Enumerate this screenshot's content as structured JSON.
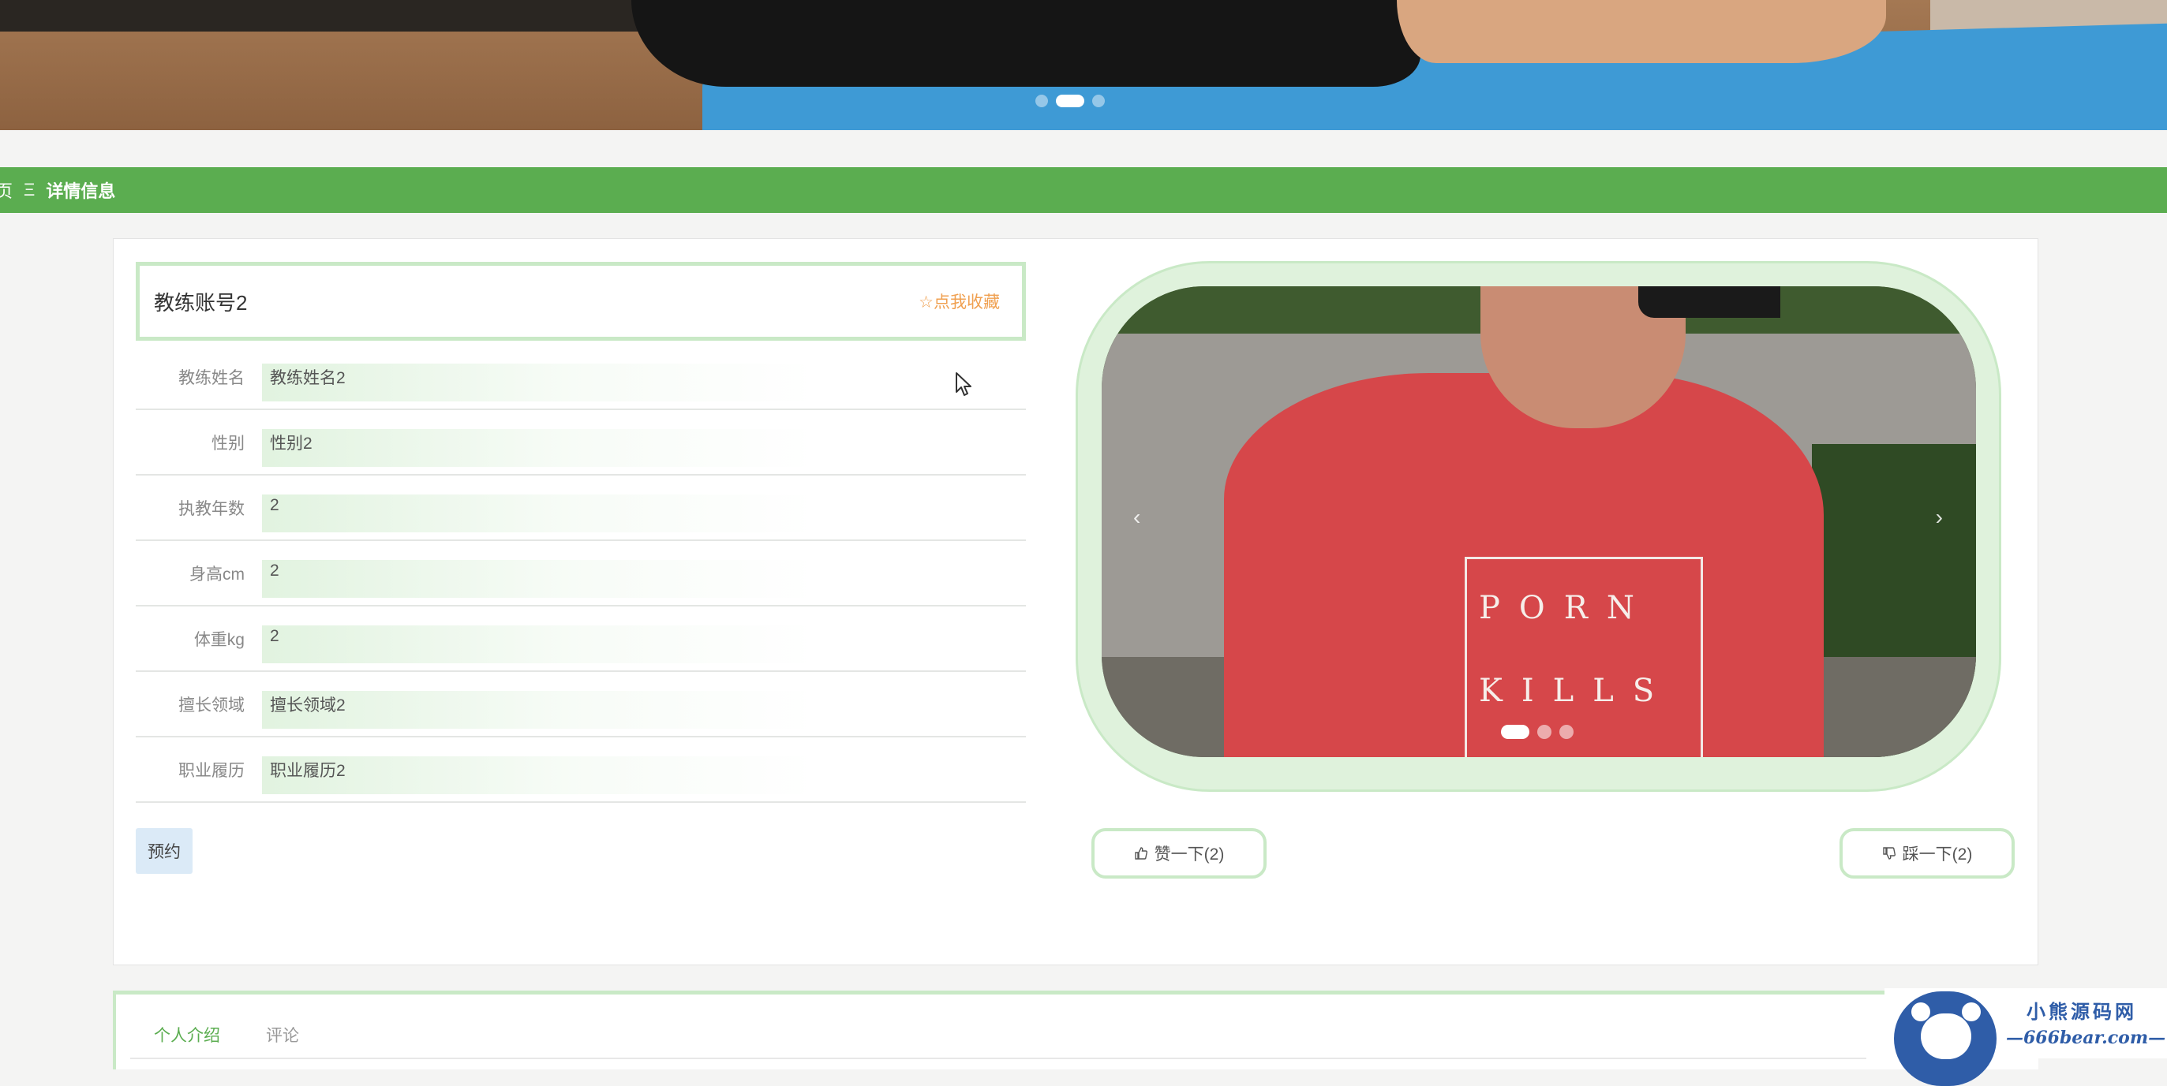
{
  "breadcrumb": {
    "home": "页",
    "separator": "Ξ",
    "current": "详情信息"
  },
  "detail": {
    "title": "教练账号2",
    "favorite_label": "☆点我收藏",
    "rows": [
      {
        "label": "教练姓名",
        "value": "教练姓名2"
      },
      {
        "label": "性别",
        "value": "性别2"
      },
      {
        "label": "执教年数",
        "value": "2"
      },
      {
        "label": "身高cm",
        "value": "2"
      },
      {
        "label": "体重kg",
        "value": "2"
      },
      {
        "label": "擅长领域",
        "value": "擅长领域2"
      },
      {
        "label": "职业履历",
        "value": "职业履历2"
      }
    ],
    "book_button": "预约"
  },
  "carousel": {
    "prev_glyph": "‹",
    "next_glyph": "›",
    "slide_count": 3,
    "active_slide": 1,
    "shirt_text_line1": "PORN",
    "shirt_text_line2": "KILLS"
  },
  "banner": {
    "slide_count": 3,
    "active_slide": 2
  },
  "votes": {
    "up_label": "赞一下(2)",
    "down_label": "踩一下(2)"
  },
  "tabs": [
    {
      "label": "个人介绍",
      "active": true
    },
    {
      "label": "评论",
      "active": false
    }
  ],
  "watermark": {
    "line1": "小熊源码网",
    "line2": "—666bear.com—"
  },
  "colors": {
    "accent_green": "#5bad50",
    "frame_green": "#c9e9c6",
    "favorite_orange": "#f0a050",
    "book_button_bg": "#dbeaf7"
  }
}
